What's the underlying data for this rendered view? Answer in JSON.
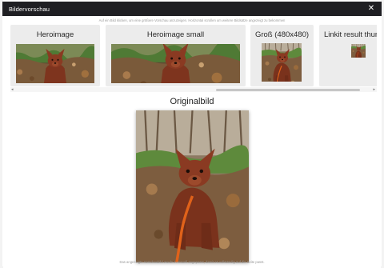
{
  "modal": {
    "title": "Bildervorschau",
    "close_icon": "close-icon",
    "close_glyph": "✕"
  },
  "hints": {
    "top": "Auf ein Bild klicken, um eine größere Vorschau anzuzeigen. Horizontal scrollen um weitere Bildsätze angezeigt zu bekommen",
    "bottom": "Das angezeigte Vorschaubild wurde eventuell angepasst, damit es vollständig auf die Seite passt."
  },
  "variants": [
    {
      "title": "Heroimage"
    },
    {
      "title": "Heroimage small"
    },
    {
      "title": "Groß (480x480)"
    },
    {
      "title": "Linkit result thumbnail"
    }
  ],
  "scrollbar": {
    "left_arrow": "◂",
    "right_arrow": "▸"
  },
  "original": {
    "title": "Originalbild"
  },
  "colors": {
    "header_bg": "#1f1f23",
    "card_bg": "#ececec",
    "dog_fur": "#8a3a22",
    "leash": "#e0621a"
  }
}
